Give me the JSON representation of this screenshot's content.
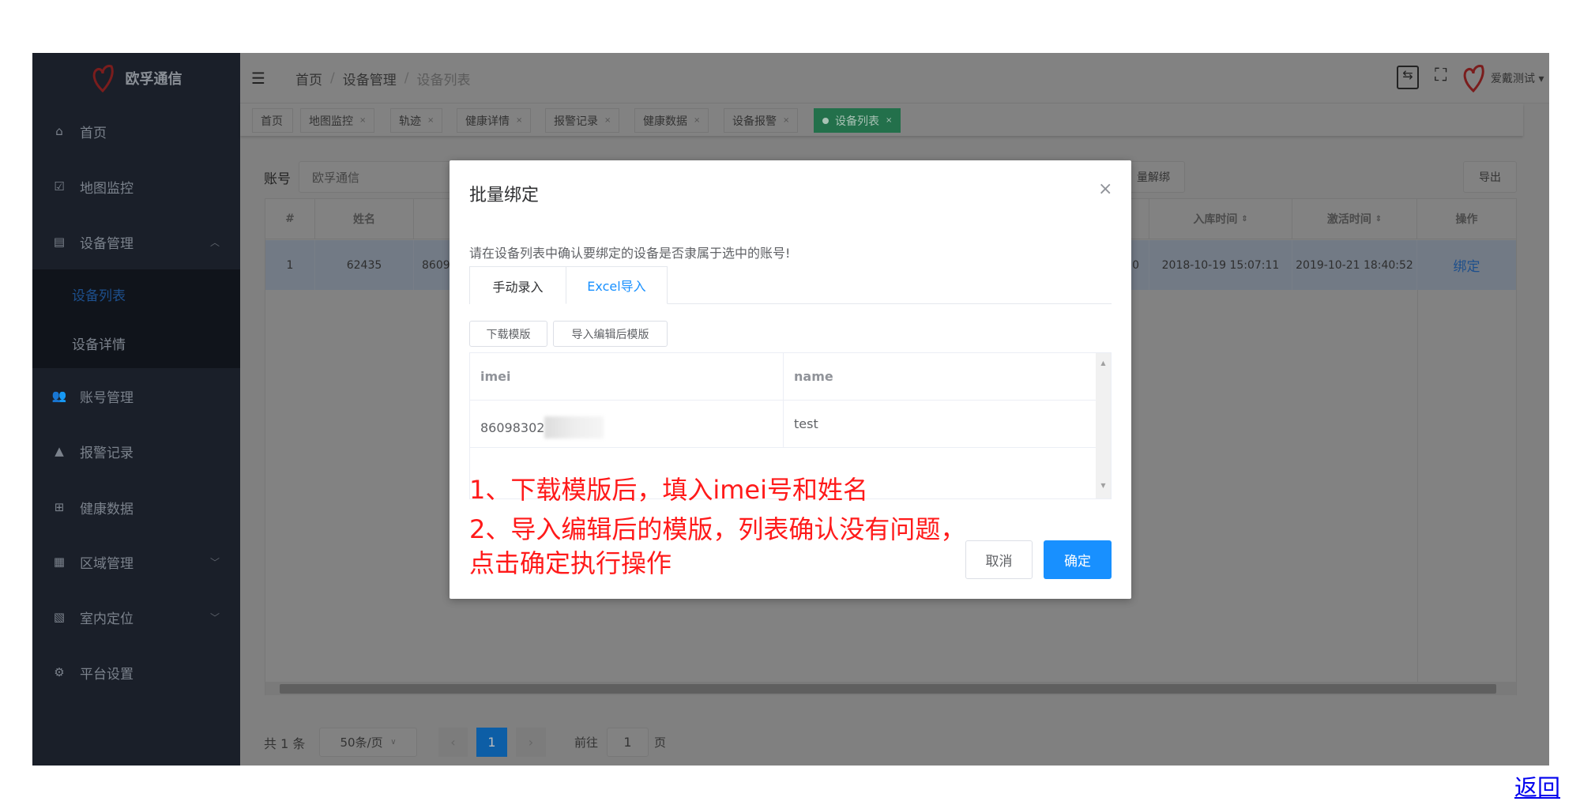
{
  "sidebar": {
    "brand": "欧孚通信",
    "items": [
      {
        "label": "首页",
        "icon": "home-icon"
      },
      {
        "label": "地图监控",
        "icon": "chart-icon"
      },
      {
        "label": "设备管理",
        "icon": "server-icon",
        "expanded": true
      },
      {
        "label": "账号管理",
        "icon": "users-icon"
      },
      {
        "label": "报警记录",
        "icon": "alarm-icon"
      },
      {
        "label": "健康数据",
        "icon": "medkit-icon"
      },
      {
        "label": "区域管理",
        "icon": "area-icon"
      },
      {
        "label": "室内定位",
        "icon": "map-pin-icon"
      },
      {
        "label": "平台设置",
        "icon": "gear-icon"
      }
    ],
    "subitems": [
      {
        "label": "设备列表",
        "active": true
      },
      {
        "label": "设备详情"
      }
    ]
  },
  "header": {
    "breadcrumb": [
      "首页",
      "设备管理",
      "设备列表"
    ],
    "user": "爱戴测试"
  },
  "tabs": [
    {
      "label": "首页"
    },
    {
      "label": "地图监控"
    },
    {
      "label": "轨迹"
    },
    {
      "label": "健康详情"
    },
    {
      "label": "报警记录"
    },
    {
      "label": "健康数据"
    },
    {
      "label": "设备报警"
    },
    {
      "label": "设备列表",
      "active": true
    }
  ],
  "filter": {
    "account_label": "账号",
    "account_value": "欧孚通信",
    "unbind_label": "量解绑",
    "export_label": "导出"
  },
  "table": {
    "headers": [
      "#",
      "姓名",
      "",
      "入库时间",
      "激活时间",
      "操作"
    ],
    "row": {
      "index": "1",
      "name": "62435",
      "imei": "8609",
      "hidden_tail": "0",
      "stock_time": "2018-10-19 15:07:11",
      "activate_time": "2019-10-21 18:40:52",
      "action": "绑定"
    }
  },
  "pagination": {
    "total": "共 1 条",
    "page_size": "50条/页",
    "current": "1",
    "goto_label": "前往",
    "goto_value": "1",
    "page_unit": "页"
  },
  "modal": {
    "title": "批量绑定",
    "description": "请在设备列表中确认要绑定的设备是否隶属于选中的账号!",
    "tabs": [
      "手动录入",
      "Excel导入"
    ],
    "active_tab": "Excel导入",
    "download_label": "下载模版",
    "import_label": "导入编辑后模版",
    "columns": [
      "imei",
      "name"
    ],
    "rows": [
      {
        "imei": "86098302",
        "name": "test"
      }
    ],
    "cancel_label": "取消",
    "confirm_label": "确定"
  },
  "annotation": {
    "line1": "1、下载模版后，填入imei号和姓名",
    "line2": "2、导入编辑后的模版，列表确认没有问题，",
    "line3": "点击确定执行操作"
  },
  "back_link": "返回",
  "colors": {
    "accent": "#1890ff",
    "active_tab": "#23704b",
    "annotation": "#ff1a1a"
  }
}
